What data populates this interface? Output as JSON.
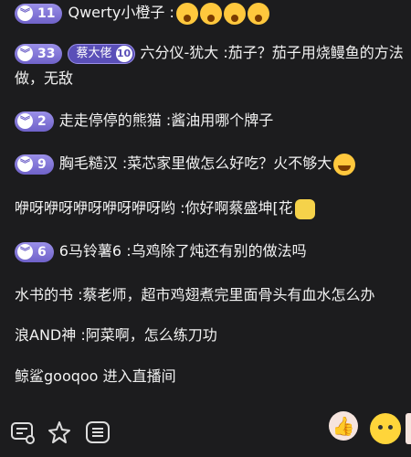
{
  "messages": [
    {
      "level": "11",
      "fan_badge": "",
      "fan_level": "",
      "user": "Qwerty小橙子",
      "text": "",
      "emojis": [
        "scream",
        "scream",
        "scream",
        "scream"
      ]
    },
    {
      "level": "33",
      "fan_badge": "蔡大佬",
      "fan_level": "10",
      "user": "六分仪-犹大",
      "text": "茄子？茄子用烧鳗鱼的方法做，无敌",
      "emojis": []
    },
    {
      "level": "2",
      "fan_badge": "",
      "fan_level": "",
      "user": "走走停停的熊猫",
      "text": "酱油用哪个牌子",
      "emojis": []
    },
    {
      "level": "9",
      "fan_badge": "",
      "fan_level": "",
      "user": "胸毛糙汉",
      "text": "菜芯家里做怎么好吃？火不够大",
      "emojis": [
        "laugh"
      ]
    },
    {
      "level": "",
      "fan_badge": "",
      "fan_level": "",
      "user": "咿呀咿呀咿呀咿呀咿呀哟",
      "text": "你好啊蔡盛坤[花",
      "emojis": [
        "cat"
      ]
    },
    {
      "level": "6",
      "fan_badge": "",
      "fan_level": "",
      "user": "6马铃薯6",
      "text": "乌鸡除了炖还有别的做法吗",
      "emojis": []
    },
    {
      "level": "",
      "fan_badge": "",
      "fan_level": "",
      "user": "水书的书",
      "text": "蔡老师，超市鸡翅煮完里面骨头有血水怎么办",
      "emojis": []
    },
    {
      "level": "",
      "fan_badge": "",
      "fan_level": "",
      "user": "浪AND神",
      "text": "阿菜啊，怎么练刀功",
      "emojis": []
    }
  ],
  "enter_notice": {
    "user": "鲸鲨gooqoo",
    "text": "进入直播间"
  },
  "separator": ":",
  "toolbar": {
    "icons": [
      "chat-settings-icon",
      "star-sparkle-icon",
      "menu-list-icon"
    ],
    "reactions": [
      "thumbs-up-icon",
      "smiley-icon"
    ]
  },
  "colors": {
    "level_badge": "#7c6fd6",
    "background": "#1c1c1e"
  }
}
